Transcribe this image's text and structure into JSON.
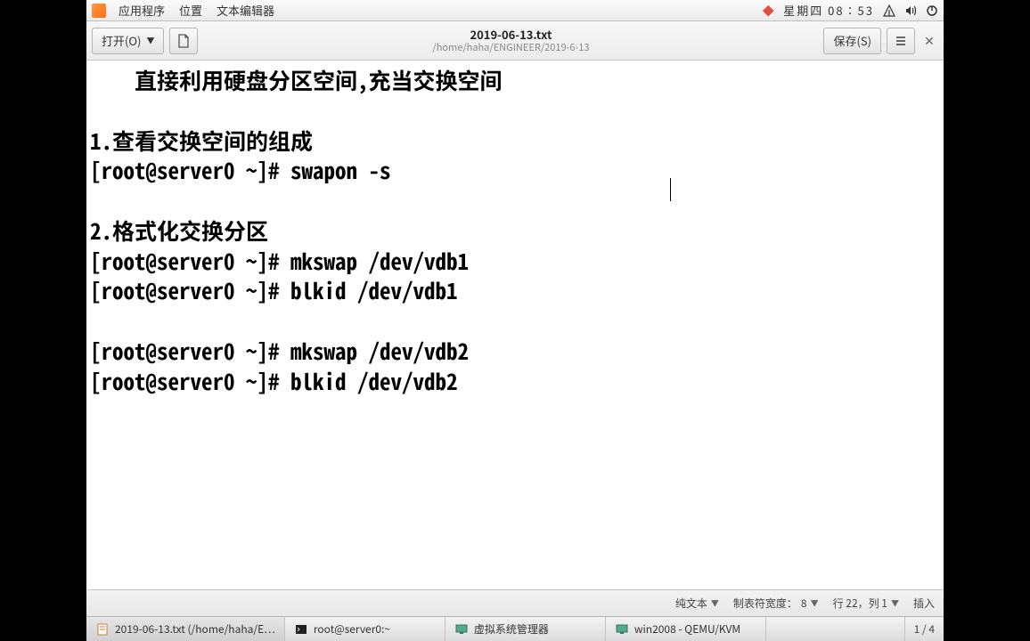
{
  "top_panel": {
    "menus": [
      "应用程序",
      "位置",
      "文本编辑器"
    ],
    "clock": "星期四 08∶53"
  },
  "editor": {
    "open_label": "打开(O)",
    "save_label": "保存(S)",
    "file_title": "2019-06-13.txt",
    "file_path": "/home/haha/ENGINEER/2019-6-13",
    "content": "    直接利用硬盘分区空间,充当交换空间\n\n1.查看交换空间的组成\n[root@server0 ~]# swapon -s\n\n2.格式化交换分区\n[root@server0 ~]# mkswap /dev/vdb1\n[root@server0 ~]# blkid /dev/vdb1\n\n[root@server0 ~]# mkswap /dev/vdb2\n[root@server0 ~]# blkid /dev/vdb2\n"
  },
  "status": {
    "syntax": "纯文本",
    "tab_width_label": "制表符宽度：",
    "tab_width": "8",
    "position": "行 22，列 1",
    "mode": "插入"
  },
  "taskbar": {
    "items": [
      {
        "label": "2019-06-13.txt (/home/haha/E…"
      },
      {
        "label": "root@server0:~"
      },
      {
        "label": "虚拟系统管理器"
      },
      {
        "label": "win2008 - QEMU/KVM"
      }
    ],
    "pager": "1  /  4"
  }
}
